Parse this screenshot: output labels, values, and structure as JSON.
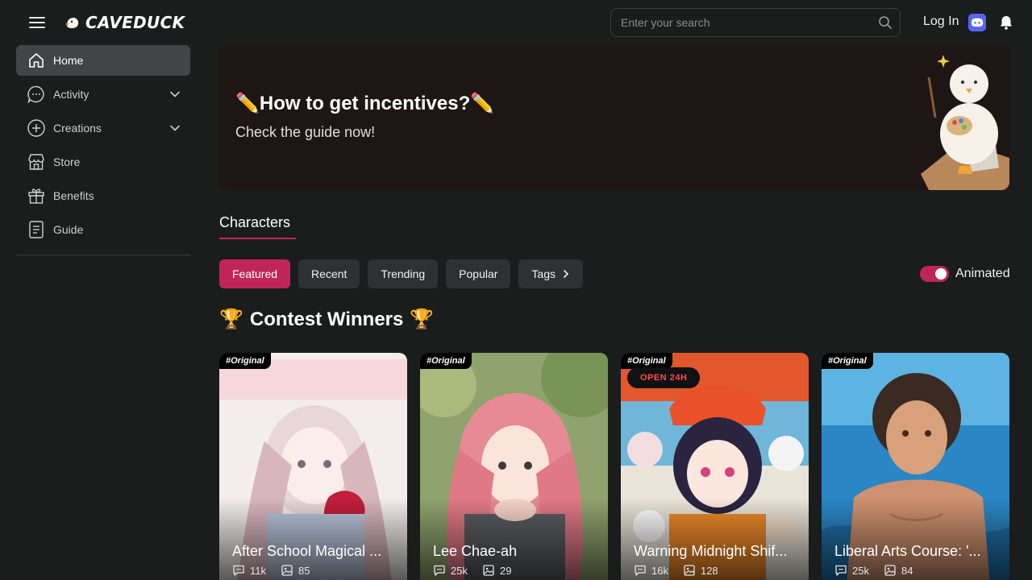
{
  "header": {
    "brand": "CAVEDUCK",
    "search_placeholder": "Enter your search",
    "login_label": "Log In"
  },
  "sidebar": {
    "items": [
      {
        "label": "Home",
        "icon": "home-icon",
        "active": true
      },
      {
        "label": "Activity",
        "icon": "chat-bubble-icon",
        "expandable": true
      },
      {
        "label": "Creations",
        "icon": "plus-circle-icon",
        "expandable": true
      },
      {
        "label": "Store",
        "icon": "store-icon"
      },
      {
        "label": "Benefits",
        "icon": "gift-icon"
      },
      {
        "label": "Guide",
        "icon": "document-icon"
      }
    ]
  },
  "banner": {
    "title": "✏️How to get incentives?✏️",
    "subtitle": "Check the guide now!"
  },
  "section": {
    "tab_label": "Characters"
  },
  "filters": {
    "chips": [
      "Featured",
      "Recent",
      "Trending",
      "Popular",
      "Tags"
    ],
    "active": "Featured",
    "toggle_label": "Animated",
    "toggle_on": true
  },
  "contest": {
    "title": "Contest Winners",
    "trophy": "🏆"
  },
  "cards": [
    {
      "tag": "#Original",
      "name": "After School Magical ...",
      "chats": "11k",
      "images": "85",
      "badge": ""
    },
    {
      "tag": "#Original",
      "name": "Lee Chae-ah",
      "chats": "25k",
      "images": "29",
      "badge": ""
    },
    {
      "tag": "#Original",
      "name": "Warning Midnight Shif...",
      "chats": "16k",
      "images": "128",
      "badge": "OPEN 24H"
    },
    {
      "tag": "#Original",
      "name": "Liberal Arts Course: '...",
      "chats": "25k",
      "images": "84",
      "badge": ""
    }
  ],
  "colors": {
    "accent": "#c0255a",
    "background": "#1b1c1c",
    "chip": "#2f3031",
    "sidebar_active": "#434445",
    "banner_bg": "#1e1614",
    "discord": "#5865f2"
  }
}
